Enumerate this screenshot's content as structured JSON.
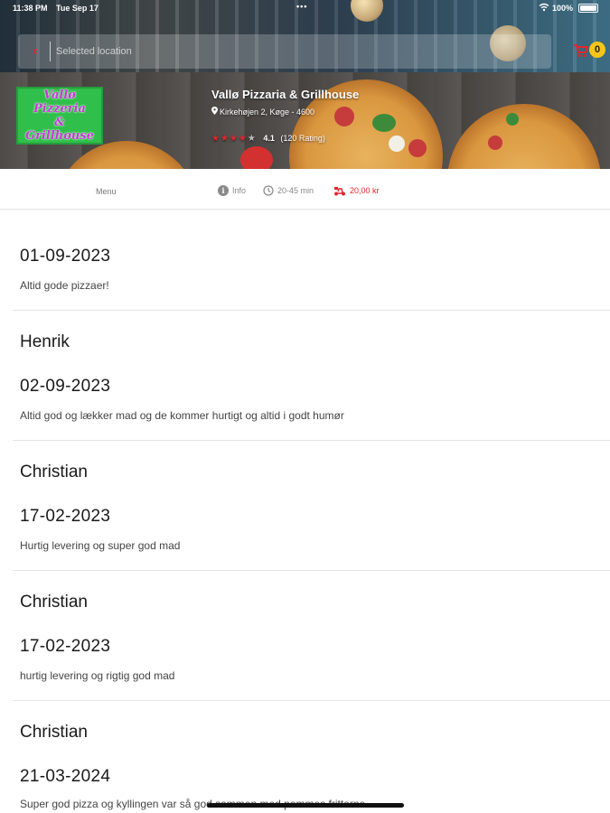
{
  "status_bar": {
    "time": "11:38 PM",
    "date": "Tue Sep 17",
    "battery_percent": "100%"
  },
  "location": {
    "placeholder": "Selected location"
  },
  "cart": {
    "count": "0"
  },
  "restaurant": {
    "logo_lines": [
      "Vallø Pizzeria",
      "&",
      "Grillhouse"
    ],
    "name": "Vallø Pizzaria & Grillhouse",
    "address": "Kirkehøjen 2, Køge - 4600",
    "rating_score": "4.1",
    "rating_count": "(120 Rating)",
    "stars_filled": 4,
    "stars_total": 5
  },
  "info_bar": {
    "menu_label": "Menu",
    "info_label": "Info",
    "delivery_time": "20-45 min",
    "delivery_fee": "20,00 kr"
  },
  "reviews": [
    {
      "name": "",
      "date": "01-09-2023",
      "text": "Altid gode pizzaer!"
    },
    {
      "name": "Henrik",
      "date": "02-09-2023",
      "text": "Altid god og lækker mad og de kommer hurtigt og altid i godt humør"
    },
    {
      "name": "Christian",
      "date": "17-02-2023",
      "text": "Hurtig levering og super god mad"
    },
    {
      "name": "Christian",
      "date": "17-02-2023",
      "text": "hurtig levering og rigtig god mad"
    },
    {
      "name": "Christian",
      "date": "21-03-2024",
      "text": "Super god pizza og kyllingen var så god sammen med pommes fritterne"
    }
  ],
  "colors": {
    "accent_red": "#e0262e",
    "badge_yellow": "#f5c518",
    "logo_green": "#2fbf4a",
    "logo_text_purple": "#c23ad0"
  },
  "icons": {
    "back": "chevron-left-icon",
    "cart": "cart-icon",
    "pin": "location-pin-icon",
    "info": "info-icon",
    "clock": "clock-icon",
    "delivery": "scooter-icon"
  }
}
